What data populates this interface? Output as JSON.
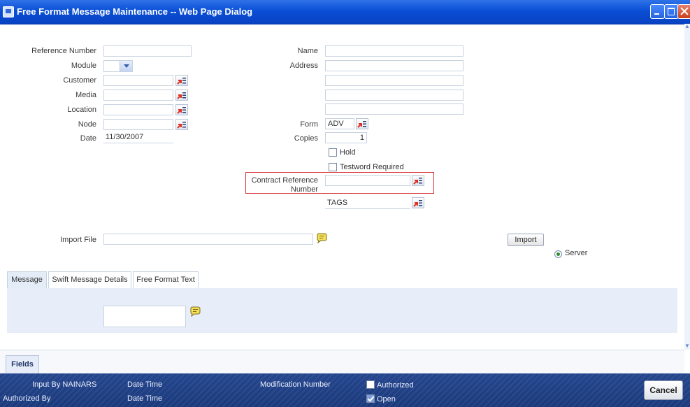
{
  "window": {
    "title": "Free Format Message Maintenance -- Web Page Dialog"
  },
  "form": {
    "reference_number_label": "Reference Number",
    "module_label": "Module",
    "customer_label": "Customer",
    "media_label": "Media",
    "location_label": "Location",
    "node_label": "Node",
    "date_label": "Date",
    "date_value": "11/30/2007",
    "name_label": "Name",
    "address_label": "Address",
    "form_label": "Form",
    "form_value": "ADV",
    "copies_label": "Copies",
    "copies_value": "1",
    "hold_label": "Hold",
    "testword_label": "Testword Required",
    "contract_ref_label_line1": "Contract Reference",
    "contract_ref_label_line2": "Number",
    "tags_value": "TAGS",
    "import_file_label": "Import File",
    "import_button": "Import",
    "server_label": "Server"
  },
  "tabs": [
    {
      "label": "Message"
    },
    {
      "label": "Swift Message Details"
    },
    {
      "label": "Free Format Text"
    }
  ],
  "fields_tab": "Fields",
  "footer": {
    "input_by": "Input By NAINARS",
    "authorized_by": "Authorized By",
    "date_time_1": "Date Time",
    "date_time_2": "Date Time",
    "modification_number": "Modification Number",
    "authorized": "Authorized",
    "open": "Open",
    "cancel_button": "Cancel"
  },
  "colors": {
    "title_bar": "#0a4fd6",
    "footer": "#1f3f84",
    "highlight": "#d6353a",
    "tab_panel": "#e7eef9"
  },
  "icons": {
    "lov": "list-of-values-icon",
    "message": "speech-bubble-icon"
  }
}
